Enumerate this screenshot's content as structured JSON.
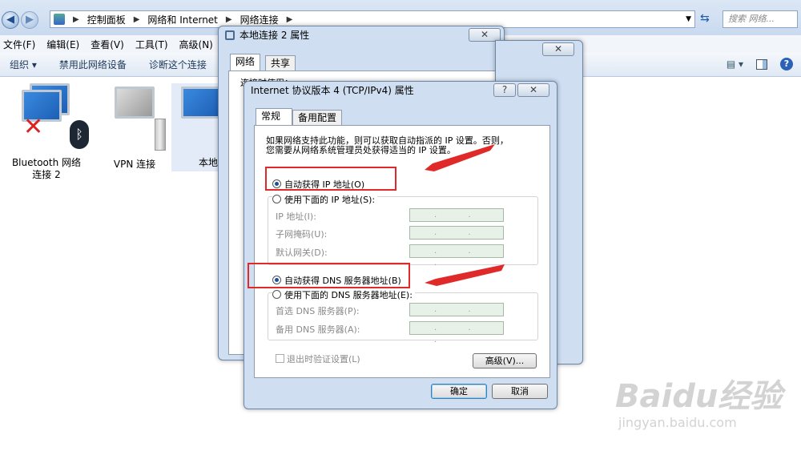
{
  "address": {
    "crumbs": [
      "控制面板",
      "网络和 Internet",
      "网络连接"
    ],
    "search_placeholder": "搜索 网络..."
  },
  "menu": [
    "文件(F)",
    "编辑(E)",
    "查看(V)",
    "工具(T)",
    "高级(N)",
    "帮"
  ],
  "toolbar": [
    "组织 ▾",
    "禁用此网络设备",
    "诊断这个连接"
  ],
  "items": [
    {
      "label": "Bluetooth 网络\n连接 2"
    },
    {
      "label": "VPN 连接"
    },
    {
      "label": "本地"
    }
  ],
  "dlg1": {
    "title": "本地连接 2 属性",
    "tabs": [
      "网络",
      "共享"
    ],
    "line1": "连接时使用：",
    "close": "✕"
  },
  "dlg2": {
    "title": "Internet 协议版本 4 (TCP/IPv4) 属性",
    "help": "?",
    "close": "✕",
    "tabs": [
      "常规",
      "备用配置"
    ],
    "desc1": "如果网络支持此功能，则可以获取自动指派的 IP 设置。否则，",
    "desc2": "您需要从网络系统管理员处获得适当的 IP 设置。",
    "auto_ip": "自动获得 IP 地址(O)",
    "manual_ip": "使用下面的 IP 地址(S):",
    "ip_label": "IP 地址(I):",
    "mask_label": "子网掩码(U):",
    "gw_label": "默认网关(D):",
    "auto_dns": "自动获得 DNS 服务器地址(B)",
    "manual_dns": "使用下面的 DNS 服务器地址(E):",
    "dns1_label": "首选 DNS 服务器(P):",
    "dns2_label": "备用 DNS 服务器(A):",
    "validate": "退出时验证设置(L)",
    "advanced": "高级(V)...",
    "ok": "确定",
    "cancel": "取消",
    "ip_dots": ". . ."
  },
  "watermark": {
    "brand": "Baidu经验",
    "url": "jingyan.baidu.com"
  },
  "colors": {
    "arrow": "#e02a2a"
  }
}
